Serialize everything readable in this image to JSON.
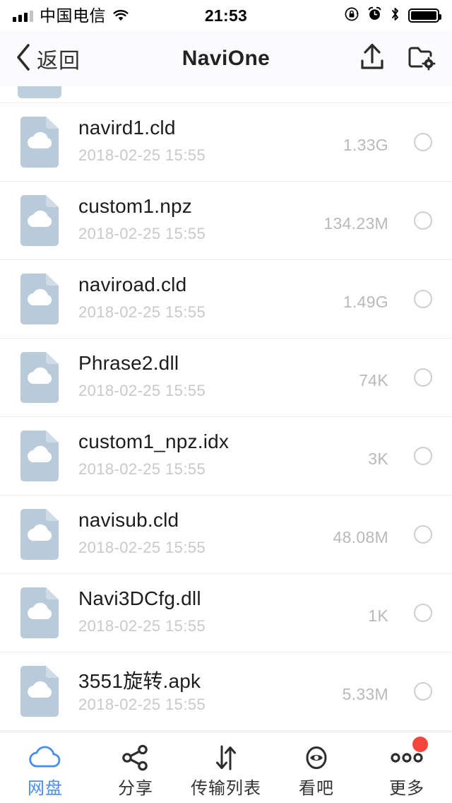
{
  "status_bar": {
    "carrier": "中国电信",
    "time": "21:53",
    "icons": [
      "signal-bars-icon",
      "wifi-icon",
      "rotation-lock-icon",
      "alarm-clock-icon",
      "bluetooth-icon",
      "battery-icon"
    ],
    "signal_bars_filled": 3,
    "signal_bars_total": 4,
    "battery_level_percent": 100
  },
  "nav_bar": {
    "back_label": "返回",
    "title": "NaviOne",
    "upload_icon": "upload-icon",
    "folder_settings_icon": "folder-settings-icon"
  },
  "file_list": {
    "files": [
      {
        "name": "navird1.cld",
        "date": "2018-02-25 15:55",
        "size": "1.33G"
      },
      {
        "name": "custom1.npz",
        "date": "2018-02-25 15:55",
        "size": "134.23M"
      },
      {
        "name": "naviroad.cld",
        "date": "2018-02-25 15:55",
        "size": "1.49G"
      },
      {
        "name": "Phrase2.dll",
        "date": "2018-02-25 15:55",
        "size": "74K"
      },
      {
        "name": "custom1_npz.idx",
        "date": "2018-02-25 15:55",
        "size": "3K"
      },
      {
        "name": "navisub.cld",
        "date": "2018-02-25 15:55",
        "size": "48.08M"
      },
      {
        "name": "Navi3DCfg.dll",
        "date": "2018-02-25 15:55",
        "size": "1K"
      },
      {
        "name": "3551旋转.apk",
        "date": "2018-02-25 15:55",
        "size": "5.33M"
      }
    ],
    "item_icon": "cloud-file-icon",
    "select_control": "select-circle-checkbox"
  },
  "tab_bar": {
    "items": [
      {
        "label": "网盘",
        "icon": "cloud-icon",
        "active": true,
        "badge": false
      },
      {
        "label": "分享",
        "icon": "share-icon",
        "active": false,
        "badge": false
      },
      {
        "label": "传输列表",
        "icon": "transfer-icon",
        "active": false,
        "badge": false
      },
      {
        "label": "看吧",
        "icon": "eye-icon",
        "active": false,
        "badge": false
      },
      {
        "label": "更多",
        "icon": "more-dots-icon",
        "active": false,
        "badge": true
      }
    ]
  },
  "colors": {
    "accent_blue": "#4a8cf0",
    "file_icon_blue": "#b9cbda",
    "badge_red": "#f6453c",
    "nav_background": "#fbfbfd",
    "separator": "#ececec",
    "muted_text": "#c9c9cc"
  }
}
